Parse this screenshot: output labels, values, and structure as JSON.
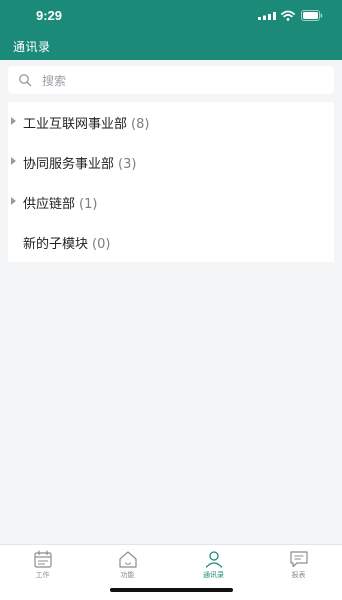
{
  "status_bar": {
    "time": "9:29"
  },
  "nav": {
    "title": "通讯录"
  },
  "search": {
    "placeholder": "搜索"
  },
  "departments": [
    {
      "name": "工业互联网事业部",
      "count": "(8)",
      "expandable": true
    },
    {
      "name": "协同服务事业部",
      "count": "(3)",
      "expandable": true
    },
    {
      "name": "供应链部",
      "count": "(1)",
      "expandable": true
    },
    {
      "name": "新的子模块",
      "count": "(0)",
      "expandable": false
    }
  ],
  "tabbar": {
    "tabs": [
      {
        "label": "工作",
        "icon": "calendar-icon",
        "active": false
      },
      {
        "label": "功能",
        "icon": "home-icon",
        "active": false
      },
      {
        "label": "通讯录",
        "icon": "person-icon",
        "active": true
      },
      {
        "label": "报表",
        "icon": "report-icon",
        "active": false
      }
    ]
  },
  "colors": {
    "accent": "#1c8a78",
    "background": "#f4f5f7",
    "text": "#222222",
    "muted": "#7d7d7d"
  }
}
